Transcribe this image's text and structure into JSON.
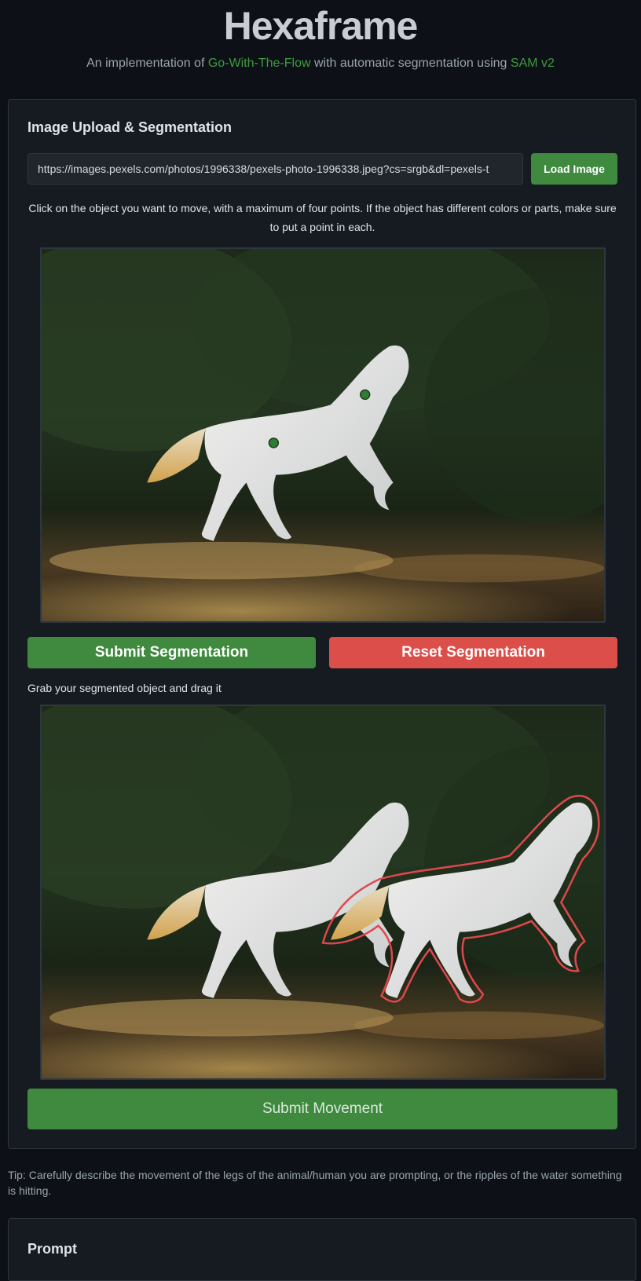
{
  "header": {
    "title": "Hexaframe",
    "subtitle_prefix": "An implementation of ",
    "subtitle_link1": "Go-With-The-Flow",
    "subtitle_middle": " with automatic segmentation using ",
    "subtitle_link2": "SAM v2"
  },
  "upload": {
    "section_title": "Image Upload & Segmentation",
    "url_value": "https://images.pexels.com/photos/1996338/pexels-photo-1996338.jpeg?cs=srgb&dl=pexels-t",
    "load_button": "Load Image",
    "instructions": "Click on the object you want to move, with a maximum of four points. If the object has different colors or parts, make sure to put a point in each.",
    "submit_button": "Submit Segmentation",
    "reset_button": "Reset Segmentation"
  },
  "drag": {
    "label": "Grab your segmented object and drag it",
    "submit_button": "Submit Movement"
  },
  "tip": "Tip: Carefully describe the movement of the legs of the animal/human you are prompting, or the ripples of the water something is hitting.",
  "prompt": {
    "section_title": "Prompt"
  },
  "colors": {
    "accent_green": "#3f8a3f",
    "danger_red": "#dc4e4a",
    "link_green": "#3f9a3f",
    "point_marker": "#2e7d32",
    "segment_outline": "#e0474c"
  },
  "icons": [
    "segmentation-point-marker"
  ]
}
